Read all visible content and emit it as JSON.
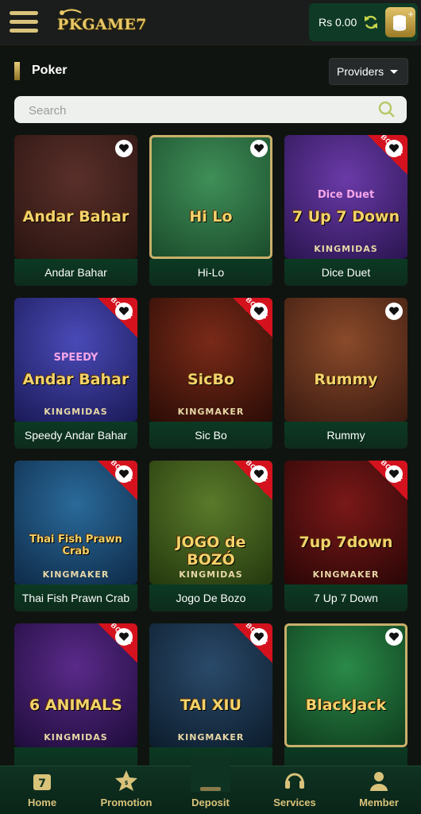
{
  "header": {
    "logo_text": "PKGAME7",
    "balance": "Rs 0.00"
  },
  "section": {
    "title": "Poker",
    "providers_label": "Providers"
  },
  "search": {
    "placeholder": "Search"
  },
  "bonus_label": "BONUS",
  "games": [
    {
      "name": "Andar Bahar",
      "art_title": "Andar Bahar",
      "brand": "",
      "bonus": false,
      "colors": [
        "#5a2f2a",
        "#2a1410"
      ]
    },
    {
      "name": "Hi-Lo",
      "art_title": "Hi Lo",
      "brand": "",
      "bonus": false,
      "colors": [
        "#3f8f58",
        "#1a4a2a"
      ]
    },
    {
      "name": "Dice Duet",
      "art_title": "7 Up 7 Down",
      "art_sub": "Dice Duet",
      "brand": "KINGMIDAS",
      "bonus": true,
      "colors": [
        "#6a3aa8",
        "#2a1550"
      ]
    },
    {
      "name": "Speedy Andar Bahar",
      "art_title": "Andar Bahar",
      "art_sub": "SPEEDY",
      "brand": "KINGMIDAS",
      "bonus": true,
      "colors": [
        "#4a4ab8",
        "#1a1a58"
      ]
    },
    {
      "name": "Sic Bo",
      "art_title": "SicBo",
      "brand": "KINGMAKER",
      "bonus": true,
      "colors": [
        "#7a2a18",
        "#2a0c06"
      ]
    },
    {
      "name": "Rummy",
      "art_title": "Rummy",
      "brand": "",
      "bonus": false,
      "colors": [
        "#8a4a2a",
        "#3a1a10"
      ]
    },
    {
      "name": "Thai Fish Prawn Crab",
      "art_title": "Thai Fish Prawn Crab",
      "brand": "KINGMAKER",
      "bonus": true,
      "colors": [
        "#2a6a9a",
        "#0e2a48"
      ]
    },
    {
      "name": "Jogo De Bozo",
      "art_title": "JOGO de BOZÓ",
      "brand": "KINGMIDAS",
      "bonus": true,
      "colors": [
        "#5a7a2a",
        "#24380e"
      ]
    },
    {
      "name": "7 Up 7 Down",
      "art_title": "7up 7down",
      "brand": "KINGMAKER",
      "bonus": true,
      "colors": [
        "#7a1818",
        "#2a0606"
      ]
    },
    {
      "name": "",
      "art_title": "6 ANIMALS",
      "brand": "KINGMIDAS",
      "bonus": true,
      "colors": [
        "#5a2a8a",
        "#1e0c3a"
      ]
    },
    {
      "name": "",
      "art_title": "TAI XIU",
      "brand": "KINGMAKER",
      "bonus": true,
      "colors": [
        "#2a4a6a",
        "#0c1c2c"
      ]
    },
    {
      "name": "",
      "art_title": "BlackJack",
      "brand": "",
      "bonus": false,
      "colors": [
        "#2a8a48",
        "#0e3a1c"
      ]
    }
  ],
  "nav": [
    {
      "label": "Home",
      "icon": "home-icon"
    },
    {
      "label": "Promotion",
      "icon": "star-icon"
    },
    {
      "label": "Deposit",
      "icon": "deposit-icon"
    },
    {
      "label": "Services",
      "icon": "headset-icon"
    },
    {
      "label": "Member",
      "icon": "user-icon"
    }
  ]
}
